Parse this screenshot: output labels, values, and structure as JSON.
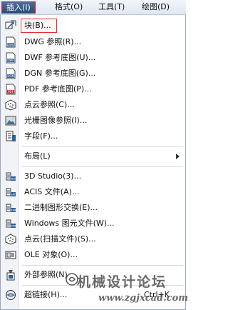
{
  "menubar": {
    "items": [
      {
        "label": "插入(I)",
        "active": true
      },
      {
        "label": "格式(O)",
        "active": false
      },
      {
        "label": "工具(T)",
        "active": false
      },
      {
        "label": "绘图(D)",
        "active": false
      }
    ]
  },
  "menu": {
    "items": [
      {
        "label": "块(B)...",
        "icon": "block-insert-icon",
        "highlighted": true
      },
      {
        "label": "DWG 参照(R)...",
        "icon": "dwg-icon"
      },
      {
        "label": "DWF 参考底图(U)...",
        "icon": "dwf-icon"
      },
      {
        "label": "DGN 参考底图(G)...",
        "icon": "dgn-icon"
      },
      {
        "label": "PDF 参考底图(P)...",
        "icon": "pdf-icon"
      },
      {
        "label": "点云参照(C)...",
        "icon": "point-cloud-icon"
      },
      {
        "label": "光栅图像参照(I)...",
        "icon": "raster-image-icon"
      },
      {
        "label": "字段(F)...",
        "icon": "field-icon"
      },
      {
        "label": "布局(L)",
        "icon": "",
        "submenu": true
      },
      {
        "label": "3D Studio(3)...",
        "icon": "3ds-icon"
      },
      {
        "label": "ACIS 文件(A)...",
        "icon": "acis-icon"
      },
      {
        "label": "二进制图形交换(E)...",
        "icon": "dxb-icon"
      },
      {
        "label": "Windows 图元文件(W)...",
        "icon": "wmf-icon"
      },
      {
        "label": "点云(扫描文件)(S)...",
        "icon": "point-cloud-scan-icon"
      },
      {
        "label": "OLE 对象(O)...",
        "icon": "ole-object-icon"
      },
      {
        "label": "外部参照(N)",
        "icon": "xref-icon"
      },
      {
        "label": "超链接(H)...",
        "icon": "hyperlink-icon",
        "shortcut": "Ctrl+K"
      }
    ]
  },
  "watermark": {
    "title": "机械设计论坛",
    "url": "www.zgjxcad.com"
  },
  "colors": {
    "active_menu_bg": "#2d4c75",
    "highlight_border": "#e03030",
    "menubar_bg": "#dfe7f3",
    "gutter_bg": "#f1f3f7"
  }
}
